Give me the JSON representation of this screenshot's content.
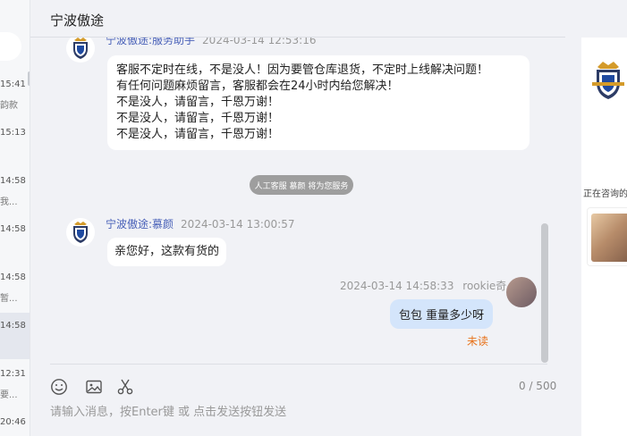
{
  "conversation_list": {
    "items": [
      {
        "time": "15:41",
        "preview": "韵款"
      },
      {
        "time": "15:13",
        "preview": ""
      },
      {
        "time": "14:58",
        "preview": "我..."
      },
      {
        "time": "14:58",
        "preview": ""
      },
      {
        "time": "14:58",
        "preview": "暂..."
      },
      {
        "time": "14:58",
        "preview": ""
      },
      {
        "time": "12:31",
        "preview": "要..."
      },
      {
        "time": "20:46",
        "preview": ""
      }
    ]
  },
  "chat": {
    "title": "宁波傲途",
    "messages": [
      {
        "sender": "宁波傲途:服务助手",
        "time": "2024-03-14 12:53:16",
        "lines": [
          "客服不定时在线，不是没人！因为要管仓库退货，不定时上线解决问题！",
          "有任何问题麻烦留言，客服都会在24小时内给您解决！",
          "不是没人，请留言，千恩万谢！",
          "不是没人，请留言，千恩万谢！",
          "不是没人，请留言，千恩万谢！"
        ]
      },
      {
        "sender": "宁波傲途:慕颜",
        "time": "2024-03-14 13:00:57",
        "lines": [
          "亲您好，这款有货的"
        ]
      }
    ],
    "system_notice": "人工客服 慕颜 将为您服务",
    "my_message": {
      "time": "2024-03-14 14:58:33",
      "sender": "rookie奇",
      "text": "包包 重量多少呀",
      "status": "未读"
    },
    "input": {
      "placeholder": "请输入消息，按Enter键 或 点击发送按钮发送",
      "char_count": "0 / 500"
    }
  },
  "right_panel": {
    "consulting_label": "正在咨询的"
  },
  "colors": {
    "accent": "#4860b8",
    "unread": "#e8731c",
    "my_bubble": "#d4e5fb",
    "system_pill": "#9e9e9e"
  },
  "icons": [
    "emoji-icon",
    "image-icon",
    "scissors-icon",
    "shop-logo-icon"
  ]
}
